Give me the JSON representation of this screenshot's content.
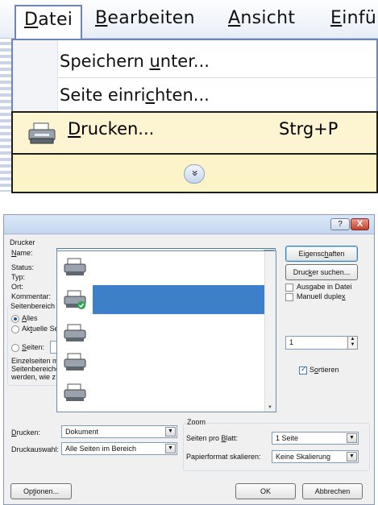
{
  "menubar": {
    "items": [
      {
        "label": "Datei",
        "mn": "D",
        "rest": "atei"
      },
      {
        "label": "Bearbeiten",
        "mn": "B",
        "rest": "earbeiten"
      },
      {
        "label": "Ansicht",
        "mn": "A",
        "rest": "nsicht"
      },
      {
        "label": "Einfü",
        "mn": "E",
        "rest": "infü"
      }
    ]
  },
  "menu": {
    "save_as": {
      "pre": "Speichern ",
      "mn": "u",
      "post": "nter..."
    },
    "page_setup": {
      "pre": "Seite einri",
      "mn": "c",
      "post": "hten..."
    },
    "print": {
      "mn": "D",
      "post": "rucken...",
      "shortcut": "Strg+P"
    },
    "expand_glyph": "»"
  },
  "dialog": {
    "help_glyph": "?",
    "close_glyph": "X",
    "printer_section": "Drucker",
    "name_label": {
      "mn": "N",
      "post": "ame:"
    },
    "status_label": "Status:",
    "type_label": "Typ:",
    "location_label": "Ort:",
    "comment_label": "Kommentar:",
    "properties_button": {
      "pre": "Eigensc",
      "mn": "h",
      "post": "aften"
    },
    "find_printer_button": {
      "pre": "Druc",
      "mn": "k",
      "post": "er suchen..."
    },
    "print_to_file": "Ausgabe in Datei",
    "manual_duplex": {
      "pre": "Manuell duple",
      "mn": "x",
      "post": ""
    },
    "page_range_section": "Seitenbereich",
    "all": {
      "mn": "A",
      "post": "lles"
    },
    "current_page": {
      "pre": "Ak",
      "mn": "t",
      "post": "uelle Se"
    },
    "pages": {
      "mn": "S",
      "post": "eiten:"
    },
    "help_lines": [
      "Einzelseiten m",
      "Seitenbereiche",
      "werden, wie z"
    ],
    "copies_value": "1",
    "collate": {
      "pre": "S",
      "mn": "o",
      "post": "rtieren"
    },
    "print_what_label": {
      "mn": "D",
      "post": "rucken:"
    },
    "print_what_value": "Dokument",
    "print_range_label": "Druckauswahl:",
    "print_range_value": "Alle Seiten im Bereich",
    "zoom_section": "Zoom",
    "pages_per_sheet_label": {
      "pre": "Seiten pro ",
      "mn": "B",
      "post": "latt:"
    },
    "pages_per_sheet_value": "1 Seite",
    "scale_label": "Papierformat skalieren:",
    "scale_value": "Keine Skalierung",
    "options_button": {
      "pre": "Op",
      "mn": "t",
      "post": "ionen..."
    },
    "ok_button": "OK",
    "cancel_button": "Abbrechen"
  }
}
